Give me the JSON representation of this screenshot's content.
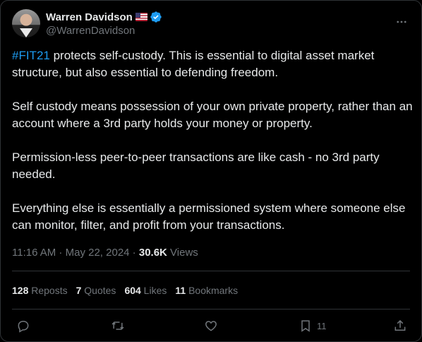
{
  "author": {
    "name": "Warren Davidson",
    "handle": "@WarrenDavidson",
    "flag": "us-flag",
    "verified": true
  },
  "tweet": {
    "hashtag": "#FIT21",
    "p1_rest": " protects self-custody. This is essential to digital asset market structure, but also essential to defending freedom.",
    "p2": "Self custody means possession of your own private property, rather than an account where a 3rd party holds your money or property.",
    "p3": "Permission-less peer-to-peer transactions are like cash - no 3rd party needed.",
    "p4": "Everything else is essentially a permissioned system where someone else can monitor, filter, and profit from your transactions."
  },
  "meta": {
    "time": "11:16 AM",
    "sep1": " · ",
    "date": "May 22, 2024",
    "sep2": " · ",
    "views_count": "30.6K",
    "views_label": " Views"
  },
  "stats": {
    "reposts": "128",
    "reposts_label": " Reposts",
    "quotes": "7",
    "quotes_label": " Quotes",
    "likes": "604",
    "likes_label": " Likes",
    "bookmarks": "11",
    "bookmarks_label": " Bookmarks"
  },
  "actions": {
    "bookmark_count": "11"
  },
  "colors": {
    "background": "#000000",
    "text": "#e7e9ea",
    "muted": "#71767b",
    "accent": "#1d9bf0",
    "divider": "#2f3336"
  }
}
